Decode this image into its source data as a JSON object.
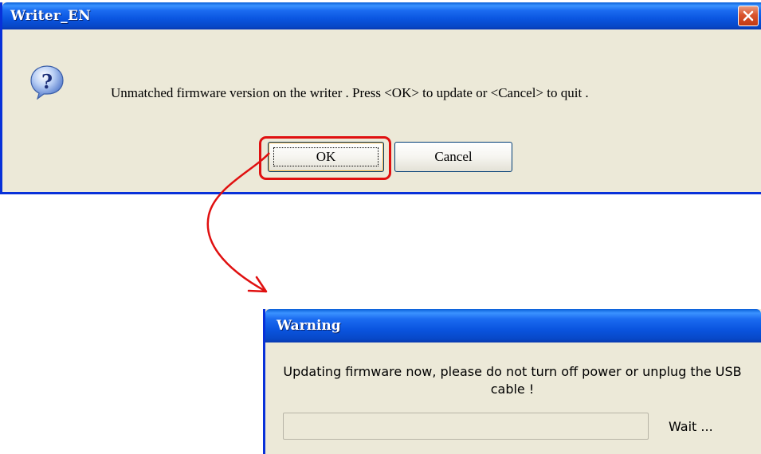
{
  "dialog1": {
    "title": "Writer_EN",
    "message": "Unmatched firmware version on the writer . Press <OK> to update or <Cancel> to quit .",
    "ok_label": "OK",
    "cancel_label": "Cancel",
    "icon": "question-icon"
  },
  "dialog2": {
    "title": "Warning",
    "message": "Updating firmware now, please do not turn off power or unplug the USB cable !",
    "status": "Wait ...",
    "progress": 0
  },
  "colors": {
    "titlebar": "#0a55e0",
    "dialog_bg": "#ece9d8",
    "highlight": "#e01010",
    "close_button": "#d9532c"
  }
}
